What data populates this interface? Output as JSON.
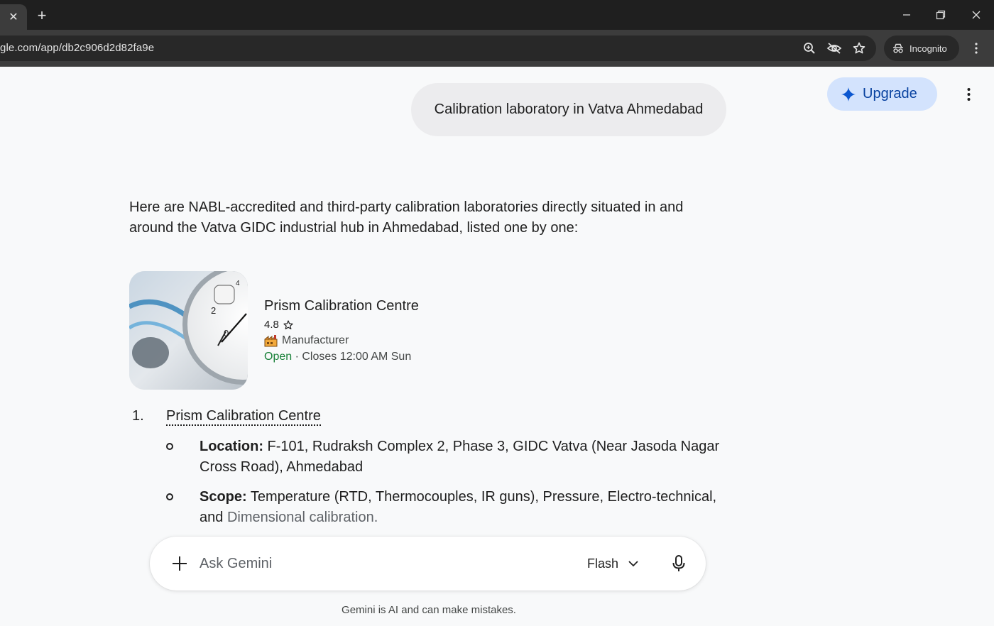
{
  "browser": {
    "tab_close_glyph": "✕",
    "new_tab_glyph": "+",
    "url": "gle.com/app/db2c906d2d82fa9e",
    "incognito_label": "Incognito",
    "icons": [
      "zoom-icon",
      "eye-off-icon",
      "star-icon",
      "incognito-icon",
      "more-vert-icon"
    ]
  },
  "header": {
    "upgrade_label": "Upgrade",
    "upgrade_color": "#d3e3fd"
  },
  "conversation": {
    "user_prompt": "Calibration laboratory in Vatva Ahmedabad",
    "intro": "Here are NABL-accredited and third-party calibration laboratories directly situated in and around the Vatva GIDC industrial hub in Ahmedabad, listed one by one:",
    "place_card": {
      "name": "Prism Calibration Centre",
      "rating": "4.8",
      "category": "Manufacturer",
      "status": "Open",
      "hours": " · Closes 12:00 AM Sun",
      "status_color": "#188038"
    },
    "list": [
      {
        "number": "1.",
        "title": "Prism Calibration Centre",
        "bullets": [
          {
            "label": "Location:",
            "text": " F-101, Rudraksh Complex 2, Phase 3, GIDC Vatva (Near Jasoda Nagar Cross Road), Ahmedabad"
          },
          {
            "label": "Scope:",
            "text": " Temperature (RTD, Thermocouples, IR guns), Pressure, Electro-technical, and ",
            "text_faded": "Dimensional calibration."
          }
        ]
      }
    ]
  },
  "input": {
    "placeholder": "Ask Gemini",
    "model_label": "Flash"
  },
  "footer": {
    "disclaimer": "Gemini is AI and can make mistakes."
  }
}
